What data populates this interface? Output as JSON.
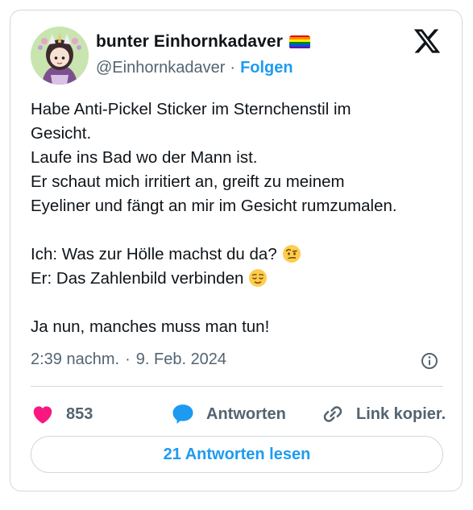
{
  "author": {
    "display_name": "bunter Einhornkadaver",
    "flag_icon": "rainbow-flag-icon",
    "handle": "@Einhornkadaver",
    "separator": "·",
    "follow_label": "Folgen"
  },
  "tweet": {
    "lines": [
      "Habe Anti-Pickel Sticker im Sternchenstil im",
      "Gesicht.",
      "Laufe ins Bad wo der Mann ist.",
      "Er schaut mich irritiert an, greift zu meinem",
      "Eyeliner und fängt an mir im Gesicht rumzumalen.",
      "Ich: Was zur Hölle machst du da?",
      "Er: Das Zahlenbild verbinden",
      "Ja nun, manches muss man tun!"
    ],
    "emoji_1": "raised-eyebrow-face-icon",
    "emoji_2": "relieved-face-icon",
    "time": "2:39 nachm.",
    "separator": "·",
    "date": "9. Feb. 2024"
  },
  "actions": {
    "like_count": "853",
    "reply_label": "Antworten",
    "copy_link_label": "Link kopier."
  },
  "read_replies_label": "21 Antworten lesen",
  "colors": {
    "accent": "#1d9bf0",
    "like": "#f91880",
    "secondary_text": "#536471",
    "border": "#cfd9de",
    "flag": [
      "#e40303",
      "#ff8c00",
      "#ffed00",
      "#008026",
      "#004dff",
      "#750787"
    ]
  }
}
